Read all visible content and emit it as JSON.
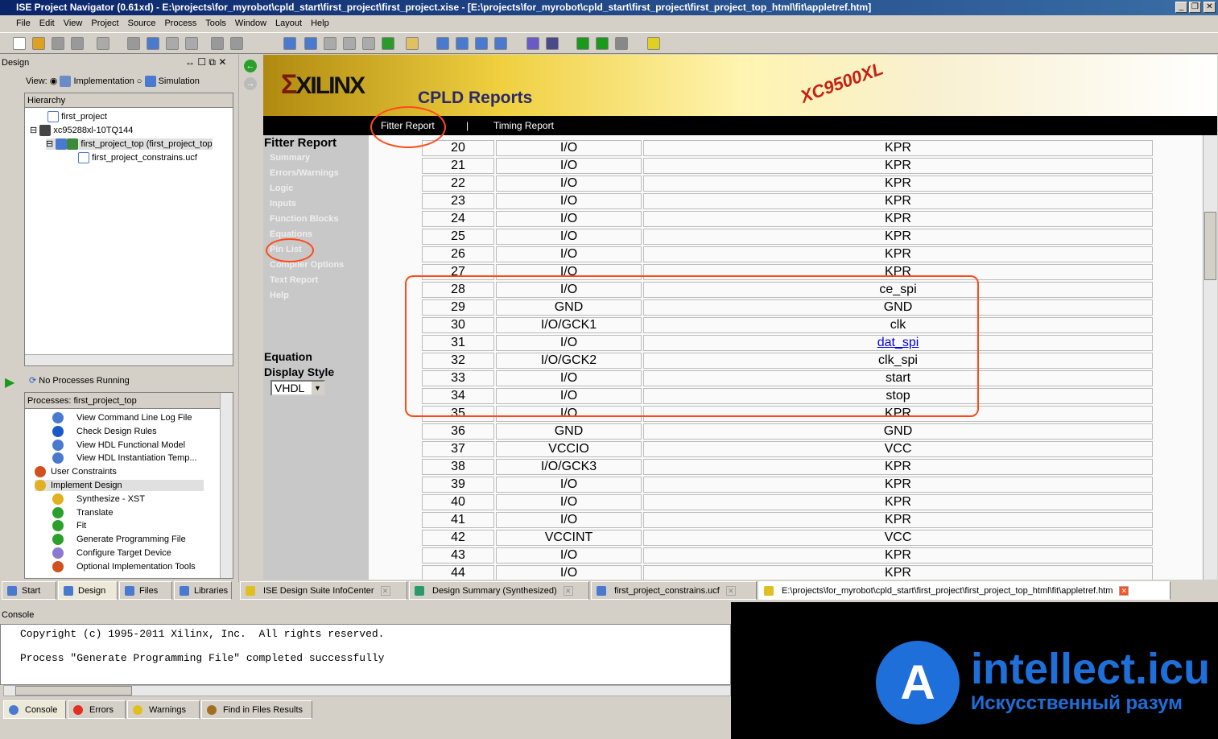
{
  "window": {
    "title": "ISE Project Navigator (0.61xd) - E:\\projects\\for_myrobot\\cpld_start\\first_project\\first_project.xise - [E:\\projects\\for_myrobot\\cpld_start\\first_project\\first_project_top_html\\fit\\appletref.htm]"
  },
  "menu": [
    "File",
    "Edit",
    "View",
    "Project",
    "Source",
    "Process",
    "Tools",
    "Window",
    "Layout",
    "Help"
  ],
  "design": {
    "header": "Design",
    "view_label": "View:",
    "impl": "Implementation",
    "sim": "Simulation",
    "hierarchy": "Hierarchy",
    "tree": [
      "first_project",
      "xc95288xl-10TQ144",
      "first_project_top (first_project_top",
      "first_project_constrains.ucf"
    ]
  },
  "processes": {
    "status": "No Processes Running",
    "header": "Processes: first_project_top",
    "items": [
      "View Command Line Log File",
      "Check Design Rules",
      "View HDL Functional Model",
      "View HDL Instantiation Temp...",
      "User Constraints",
      "Implement Design",
      "Synthesize - XST",
      "Translate",
      "Fit",
      "Generate Programming File",
      "Configure Target Device",
      "Optional Implementation Tools"
    ]
  },
  "left_tabs": [
    "Start",
    "Design",
    "Files",
    "Libraries"
  ],
  "report": {
    "logo": "XILINX",
    "title": "CPLD Reports",
    "device": "XC9500XL",
    "nav": [
      "Fitter Report",
      "|",
      "Timing Report"
    ],
    "side_title": "Fitter Report",
    "side_links": [
      "Summary",
      "Errors/Warnings",
      "Logic",
      "Inputs",
      "Function Blocks",
      "Equations",
      "Pin List",
      "Compiler Options",
      "Text Report",
      "Help"
    ],
    "eq_label1": "Equation",
    "eq_label2": "Display Style",
    "eq_value": "VHDL",
    "rows": [
      [
        "20",
        "I/O",
        "KPR"
      ],
      [
        "21",
        "I/O",
        "KPR"
      ],
      [
        "22",
        "I/O",
        "KPR"
      ],
      [
        "23",
        "I/O",
        "KPR"
      ],
      [
        "24",
        "I/O",
        "KPR"
      ],
      [
        "25",
        "I/O",
        "KPR"
      ],
      [
        "26",
        "I/O",
        "KPR"
      ],
      [
        "27",
        "I/O",
        "KPR"
      ],
      [
        "28",
        "I/O",
        "ce_spi"
      ],
      [
        "29",
        "GND",
        "GND"
      ],
      [
        "30",
        "I/O/GCK1",
        "clk"
      ],
      [
        "31",
        "I/O",
        "dat_spi"
      ],
      [
        "32",
        "I/O/GCK2",
        "clk_spi"
      ],
      [
        "33",
        "I/O",
        "start"
      ],
      [
        "34",
        "I/O",
        "stop"
      ],
      [
        "35",
        "I/O",
        "KPR"
      ],
      [
        "36",
        "GND",
        "GND"
      ],
      [
        "37",
        "VCCIO",
        "VCC"
      ],
      [
        "38",
        "I/O/GCK3",
        "KPR"
      ],
      [
        "39",
        "I/O",
        "KPR"
      ],
      [
        "40",
        "I/O",
        "KPR"
      ],
      [
        "41",
        "I/O",
        "KPR"
      ],
      [
        "42",
        "VCCINT",
        "VCC"
      ],
      [
        "43",
        "I/O",
        "KPR"
      ],
      [
        "44",
        "I/O",
        "KPR"
      ]
    ]
  },
  "doc_tabs": [
    "ISE Design Suite InfoCenter",
    "Design Summary (Synthesized)",
    "first_project_constrains.ucf",
    "E:\\projects\\for_myrobot\\cpld_start\\first_project\\first_project_top_html\\fit\\appletref.htm"
  ],
  "console": {
    "label": "Console",
    "lines": [
      "Copyright (c) 1995-2011 Xilinx, Inc.  All rights reserved.",
      "",
      "Process \"Generate Programming File\" completed successfully"
    ]
  },
  "console_tabs": [
    "Console",
    "Errors",
    "Warnings",
    "Find in Files Results"
  ],
  "watermark": {
    "brand": "intellect.icu",
    "sub": "Искусственный разум"
  },
  "colors": {
    "accent": "#ff4a1a",
    "link": "#0000ee",
    "title": "#0a246a"
  }
}
